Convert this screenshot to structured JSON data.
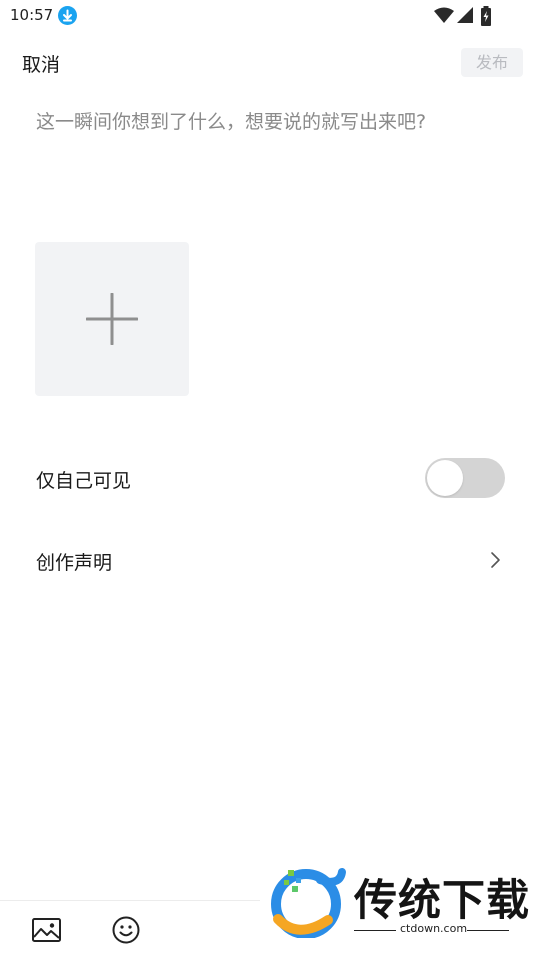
{
  "status_bar": {
    "time": "10:57",
    "download_icon": "download-icon",
    "wifi_icon": "wifi-icon",
    "signal_icon": "signal-icon",
    "battery_icon": "battery-charging-icon"
  },
  "header": {
    "cancel_label": "取消",
    "publish_label": "发布"
  },
  "composer": {
    "value": "",
    "placeholder": "这一瞬间你想到了什么，想要说的就写出来吧?",
    "add_image_icon": "plus-icon"
  },
  "settings": {
    "private_label": "仅自己可见",
    "private_enabled": false,
    "statement_label": "创作声明",
    "statement_icon": "chevron-right-icon"
  },
  "toolbar": {
    "image_icon": "image-icon",
    "emoji_icon": "emoji-icon"
  },
  "watermark": {
    "title": "传统下载",
    "url": "ctdown.com"
  },
  "colors": {
    "accent_blue": "#1aa3f0",
    "publish_bg": "#f2f3f5",
    "publish_text": "#b9bbc0",
    "placeholder_text": "#8a8a8a",
    "toggle_off": "#d4d4d4"
  }
}
